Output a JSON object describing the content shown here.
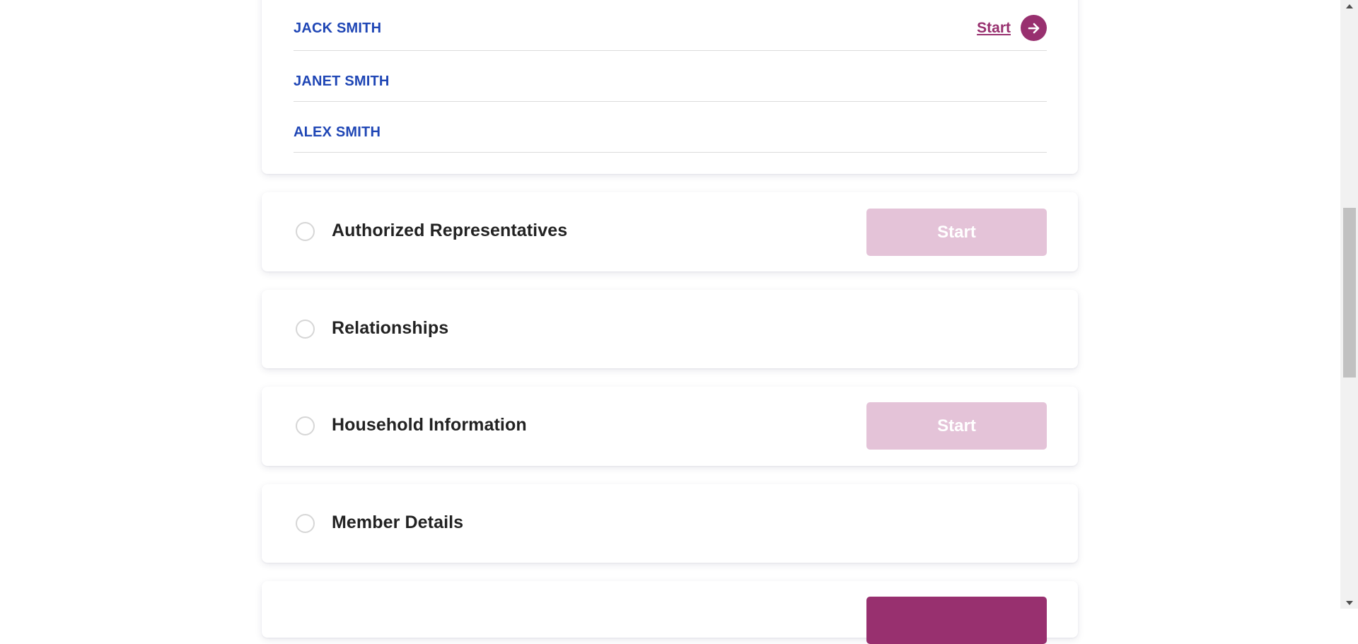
{
  "members": [
    {
      "name": "JACK SMITH",
      "start_label": "Start"
    },
    {
      "name": "JANET SMITH"
    },
    {
      "name": "ALEX SMITH"
    }
  ],
  "sections": [
    {
      "title": "Authorized Representatives",
      "button_label": "Start"
    },
    {
      "title": "Relationships"
    },
    {
      "title": "Household Information",
      "button_label": "Start"
    },
    {
      "title": "Member Details"
    }
  ],
  "colors": {
    "brand": "#98306f",
    "brand_disabled": "#e4c3d8",
    "member_link": "#1f46b5",
    "title_text": "#222222"
  },
  "icons": {
    "row_start": "arrow-right-circle-icon",
    "section_status": "empty-circle-icon",
    "scroll_up": "triangle-up-icon",
    "scroll_down": "triangle-down-icon"
  }
}
